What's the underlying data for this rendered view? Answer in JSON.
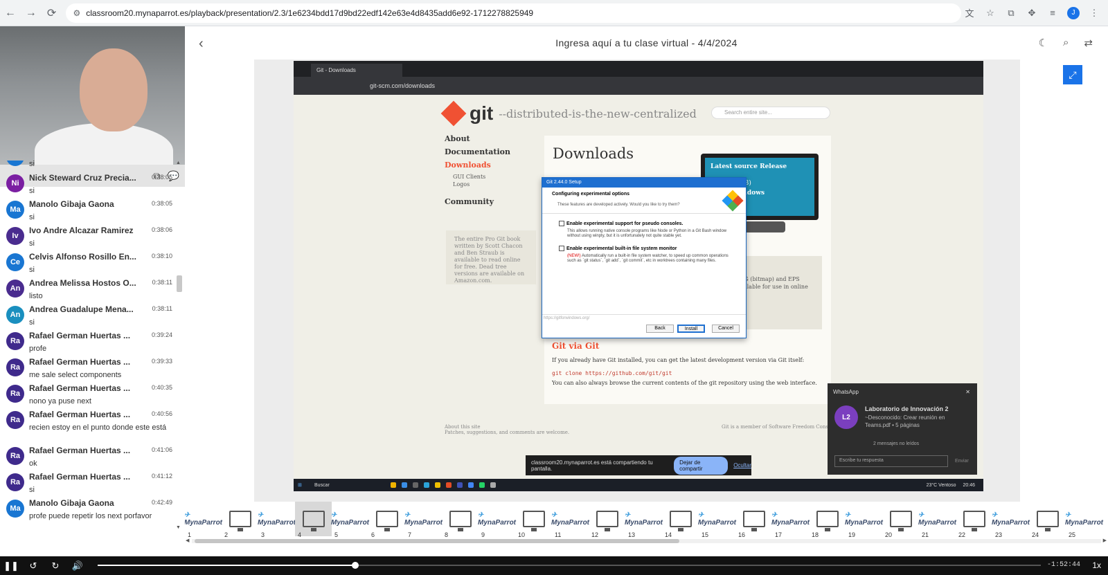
{
  "browser": {
    "url": "classroom20.mynaparrot.es/playback/presentation/2.3/1e6234bdd17d9bd22edf142e63e4d8435add6e92-1712278825949",
    "profile_initial": "J"
  },
  "header": {
    "title": "Ingresa aquí a tu clase virtual - 4/4/2024"
  },
  "chat": {
    "partial_top_text": "si",
    "messages": [
      {
        "initials": "Ni",
        "color": "#7b1fa2",
        "name": "Nick Steward Cruz Precia...",
        "time": "0:38:05",
        "text": "si"
      },
      {
        "initials": "Ma",
        "color": "#1976d2",
        "name": "Manolo Gibaja Gaona",
        "time": "0:38:05",
        "text": "si"
      },
      {
        "initials": "Iv",
        "color": "#4a2c8f",
        "name": "Ivo Andre Alcazar Ramirez",
        "time": "0:38:06",
        "text": "si"
      },
      {
        "initials": "Ce",
        "color": "#1976d2",
        "name": "Celvis Alfonso Rosillo En...",
        "time": "0:38:10",
        "text": "si"
      },
      {
        "initials": "An",
        "color": "#4a2c8f",
        "name": "Andrea Melissa Hostos O...",
        "time": "0:38:11",
        "text": "listo"
      },
      {
        "initials": "An",
        "color": "#1a8fbf",
        "name": "Andrea Guadalupe Mena...",
        "time": "0:38:11",
        "text": "si"
      },
      {
        "initials": "Ra",
        "color": "#3f2a8c",
        "name": "Rafael German Huertas ...",
        "time": "0:39:24",
        "text": "profe"
      },
      {
        "initials": "Ra",
        "color": "#3f2a8c",
        "name": "Rafael German Huertas ...",
        "time": "0:39:33",
        "text": "me sale select components"
      },
      {
        "initials": "Ra",
        "color": "#3f2a8c",
        "name": "Rafael German Huertas ...",
        "time": "0:40:35",
        "text": "nono ya puse next"
      },
      {
        "initials": "Ra",
        "color": "#3f2a8c",
        "name": "Rafael German Huertas ...",
        "time": "0:40:56",
        "text": "recien estoy en el punto donde este está"
      },
      {
        "initials": "Ra",
        "color": "#3f2a8c",
        "name": "Rafael German Huertas ...",
        "time": "0:41:06",
        "text": "ok"
      },
      {
        "initials": "Ra",
        "color": "#3f2a8c",
        "name": "Rafael German Huertas ...",
        "time": "0:41:12",
        "text": "si"
      },
      {
        "initials": "Ma",
        "color": "#1976d2",
        "name": "Manolo Gibaja Gaona",
        "time": "0:42:49",
        "text": "profe puede repetir los next porfavor"
      }
    ]
  },
  "screen": {
    "tab_label": "Git - Downloads",
    "url": "git-scm.com/downloads",
    "git_word": "git",
    "tagline": "--distributed-is-the-new-centralized",
    "search_placeholder": "Search entire site...",
    "nav": [
      "About",
      "Documentation",
      "Downloads",
      "GUI Clients",
      "Logos",
      "Community"
    ],
    "book_text": "The entire Pro Git book written by Scott Chacon and Ben Straub is available to read online for free. Dead tree versions are available on Amazon.com.",
    "downloads_heading": "Downloads",
    "release_label": "Latest source Release",
    "release_date": "(2024-02-23)",
    "download_windows": "ad for Windows",
    "side_text": "PNG (bitmap) and EPS available for use in online",
    "via_git": "Git via Git",
    "via_text": "If you already have Git installed, you can get the latest development version via Git itself:",
    "clone_cmd": "git clone https://github.com/git/git",
    "browse_text": "You can also always browse the current contents of the git repository using the web interface.",
    "footer_left": "About this site",
    "footer_left_sub": "Patches, suggestions, and comments are welcome.",
    "footer_right": "Git is a member of Software Freedom Conservan",
    "dialog": {
      "title": "Git 2.44.0 Setup",
      "heading": "Configuring experimental options",
      "subheading": "These features are developed actively. Would you like to try them?",
      "opt1_label": "Enable experimental support for pseudo consoles.",
      "opt1_desc": "This allows running native console programs like Node or Python in a Git Bash window without using winpty, but it is unfortunately not quite stable yet.",
      "opt2_label": "Enable experimental built-in file system monitor",
      "opt2_new": "(NEW!)",
      "opt2_desc": "Automatically run a built-in file system watcher, to speed up common operations such as `git status`, `git add`, `git commit`, etc in worktrees containing many files.",
      "url": "https://gitforwindows.org/",
      "back": "Back",
      "install": "Install",
      "cancel": "Cancel"
    },
    "share_text": "classroom20.mynaparrot.es está compartiendo tu pantalla.",
    "share_button": "Dejar de compartir",
    "share_hide": "Ocultar",
    "whatsapp": {
      "app": "WhatsApp",
      "avatar": "L2",
      "name": "Laboratorio de Innovación 2",
      "sub": "~Desconocido: Crear reunión en Teams.pdf • 5 páginas",
      "unread": "2 mensajes no leídos",
      "input_placeholder": "Escribe tu respuesta",
      "send": "Enviar"
    },
    "taskbar": {
      "search": "Buscar",
      "weather": "23°C Ventoso",
      "time": "20:46"
    }
  },
  "thumbnails": {
    "selected": 4,
    "logo_text": "MynaParrot",
    "items": [
      {
        "num": "1",
        "kind": "logo"
      },
      {
        "num": "2",
        "kind": "monitor"
      },
      {
        "num": "3",
        "kind": "logo"
      },
      {
        "num": "4",
        "kind": "monitor"
      },
      {
        "num": "5",
        "kind": "logo"
      },
      {
        "num": "6",
        "kind": "monitor"
      },
      {
        "num": "7",
        "kind": "logo"
      },
      {
        "num": "8",
        "kind": "monitor"
      },
      {
        "num": "9",
        "kind": "logo"
      },
      {
        "num": "10",
        "kind": "monitor"
      },
      {
        "num": "11",
        "kind": "logo"
      },
      {
        "num": "12",
        "kind": "monitor"
      },
      {
        "num": "13",
        "kind": "logo"
      },
      {
        "num": "14",
        "kind": "monitor"
      },
      {
        "num": "15",
        "kind": "logo"
      },
      {
        "num": "16",
        "kind": "monitor"
      },
      {
        "num": "17",
        "kind": "logo"
      },
      {
        "num": "18",
        "kind": "monitor"
      },
      {
        "num": "19",
        "kind": "logo"
      },
      {
        "num": "20",
        "kind": "monitor"
      },
      {
        "num": "21",
        "kind": "logo"
      },
      {
        "num": "22",
        "kind": "monitor"
      },
      {
        "num": "23",
        "kind": "logo"
      },
      {
        "num": "24",
        "kind": "monitor"
      },
      {
        "num": "25",
        "kind": "logo"
      }
    ]
  },
  "player": {
    "progress_fraction": 0.273,
    "remaining": "-1:52:44",
    "speed": "1x"
  }
}
